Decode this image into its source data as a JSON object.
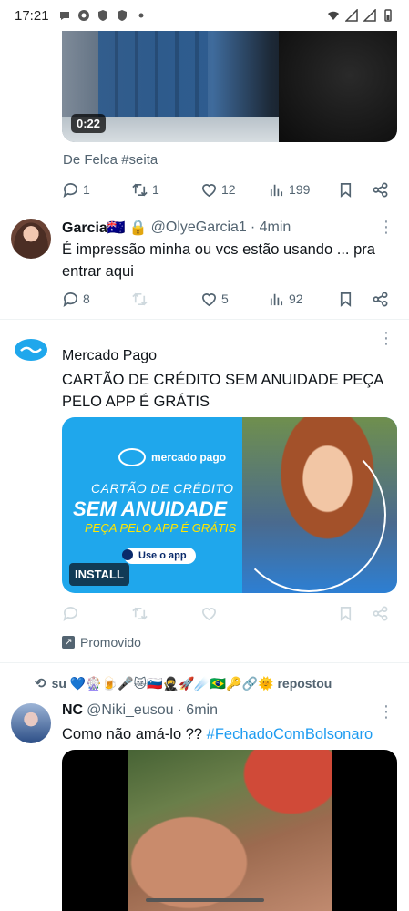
{
  "status_bar": {
    "time": "17:21",
    "icons": [
      "message-icon",
      "chrome-icon",
      "shield-icon",
      "shield-icon",
      "dot-icon"
    ],
    "right_icons": [
      "wifi-icon",
      "signal-icon",
      "signal-icon",
      "battery-icon"
    ]
  },
  "tweet1": {
    "video_duration": "0:22",
    "caption": "De Felca #seita",
    "replies": "1",
    "retweets": "1",
    "likes": "12",
    "views": "199"
  },
  "tweet2": {
    "name": "Garcia🇦🇺",
    "handle": "@OlyeGarcia1",
    "time": "· 4min",
    "text": "É impressão minha ou vcs estão usando ... pra entrar aqui",
    "replies": "8",
    "retweets": "",
    "likes": "5",
    "views": "92"
  },
  "ad": {
    "name": "Mercado Pago",
    "text": "CARTÃO DE CRÉDITO SEM ANUIDADE PEÇA PELO APP É GRÁTIS",
    "card": {
      "logo": "mercado pago",
      "line1": "CARTÃO DE CRÉDITO",
      "line2": "SEM ANUIDADE",
      "line3": "PEÇA PELO APP É GRÁTIS",
      "use_app": "Use o app",
      "install": "INSTALL"
    },
    "promoted": "Promovido"
  },
  "repost": {
    "text": "su 💙🎡🍺🎤😿🇸🇮🥷🚀☄️🇧🇷🔑🔗🌞 repostou"
  },
  "tweet3": {
    "name": "NC",
    "handle": "@Niki_eusou",
    "time": "· 6min",
    "text": "Como não amá-lo ?? ",
    "hashtag": "#FechadoComBolsonaro"
  },
  "colors": {
    "accent": "#1d9bf0",
    "muted": "#536471",
    "ad_blue": "#1fa7ec"
  }
}
